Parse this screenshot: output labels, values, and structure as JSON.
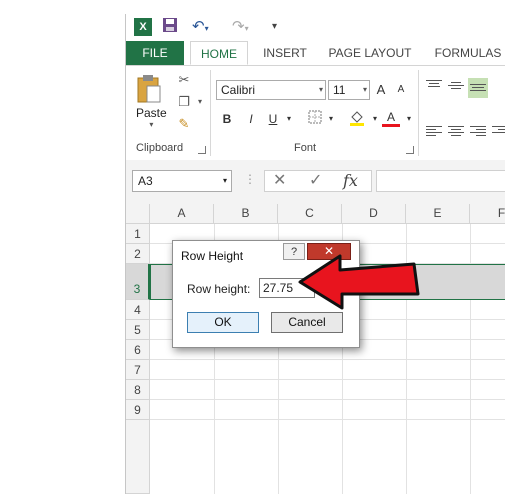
{
  "qat": {
    "undo_label": "↶",
    "redo_label": "↷"
  },
  "tabs": [
    {
      "label": "FILE"
    },
    {
      "label": "HOME"
    },
    {
      "label": "INSERT"
    },
    {
      "label": "PAGE LAYOUT"
    },
    {
      "label": "FORMULAS"
    }
  ],
  "ribbon": {
    "clipboard": {
      "group_label": "Clipboard",
      "paste_label": "Paste"
    },
    "font": {
      "group_label": "Font",
      "font_name": "Calibri",
      "font_size": "11",
      "bold": "B",
      "italic": "I",
      "underline": "U",
      "grow": "A",
      "shrink": "A",
      "font_color": "A"
    }
  },
  "formula_bar": {
    "name_box": "A3",
    "cancel": "✕",
    "enter": "✓",
    "fx": "fx"
  },
  "columns": [
    "A",
    "B",
    "C",
    "D",
    "E",
    "F"
  ],
  "rows": [
    "1",
    "2",
    "3",
    "4",
    "5",
    "6",
    "7",
    "8",
    "9"
  ],
  "dialog": {
    "title": "Row Height",
    "help": "?",
    "close": "✕",
    "field_label": "Row height:",
    "field_value": "27.75",
    "ok_label": "OK",
    "cancel_label": "Cancel"
  },
  "colors": {
    "excel_green": "#217346",
    "arrow_red": "#e8141e",
    "selection_gray": "#d8d8d8"
  }
}
